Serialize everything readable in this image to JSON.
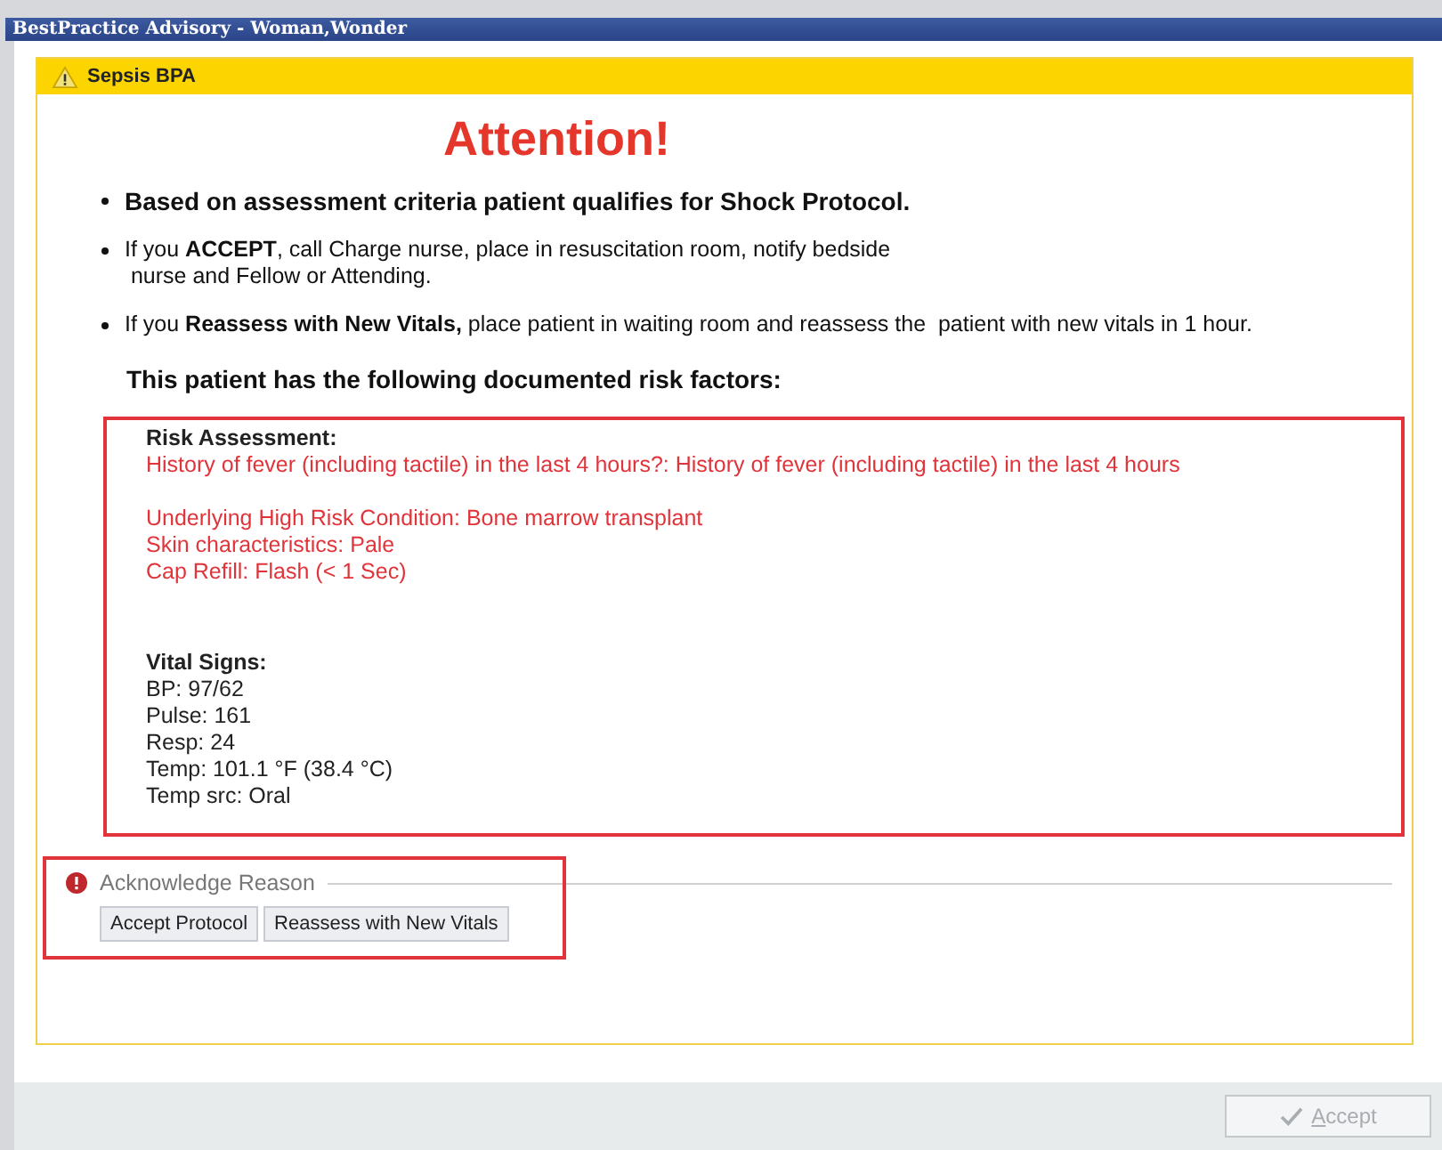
{
  "window": {
    "title": "BestPractice Advisory  - Woman,Wonder"
  },
  "alert": {
    "title": "Sepsis BPA",
    "heading": "Attention!"
  },
  "bullets": [
    {
      "kind": "lead",
      "text": "Based on assessment criteria patient qualifies for Shock Protocol."
    },
    {
      "kind": "normal",
      "text": "If you **ACCEPT**, call Charge nurse, place in resuscitation room, notify bedside\n nurse and Fellow or Attending."
    },
    {
      "kind": "normal",
      "text": "If you **Reassess with New Vitals,** place patient in waiting room and reassess the  patient with new vitals in 1 hour."
    }
  ],
  "risk_intro": "This patient has the following documented risk factors:",
  "risk_assessment": {
    "heading": "Risk Assessment:",
    "groups": [
      [
        "History of fever (including tactile) in the last 4 hours?: History of fever (including tactile) in the last 4 hours"
      ],
      [
        "Underlying High Risk Condition: Bone marrow transplant",
        "Skin characteristics: Pale",
        "Cap Refill: Flash (< 1 Sec)"
      ]
    ]
  },
  "vital_signs": {
    "heading": "Vital Signs:",
    "lines": [
      "BP: 97/62",
      "Pulse: 161",
      "Resp: 24",
      "Temp: 101.1 °F (38.4 °C)",
      "Temp src: Oral"
    ]
  },
  "acknowledge": {
    "label": "Acknowledge Reason",
    "options": [
      {
        "label": "Accept Protocol",
        "selected": false
      },
      {
        "label": "Reassess with New Vitals",
        "selected": false
      }
    ]
  },
  "footer": {
    "accept_button": {
      "label": "Accept",
      "disabled": true
    }
  }
}
